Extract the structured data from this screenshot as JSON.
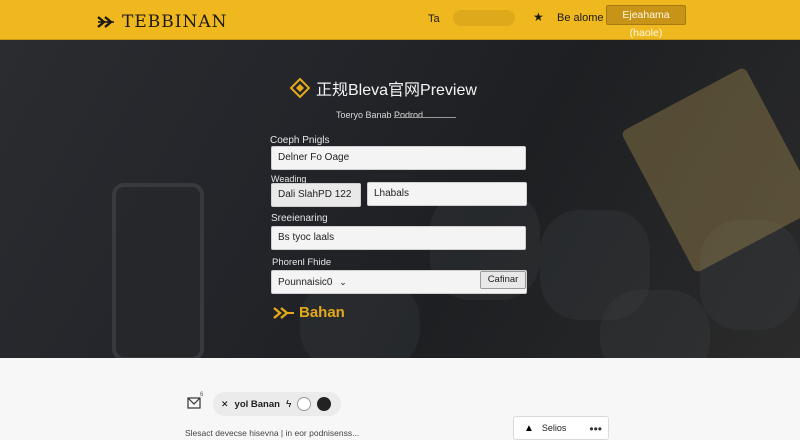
{
  "header": {
    "brand": "TEBBINAN",
    "nav_short": "Ta",
    "nav_link": "Be alome",
    "nav_button": "Ejeahama (haole)",
    "star_icon": "star-icon"
  },
  "hero": {
    "title": "正规Bleva官网Preview",
    "subtitle": "Toeryo Banab Podrod",
    "label_1": "Coeph Pnigls",
    "field_1": "Delner Fo Oage",
    "label_2": "Weading",
    "field_2a": "Dali SlahPD   122",
    "field_2b": "Lhabals",
    "label_3": "Sreeienaring",
    "field_3": "Bs tyoc laals",
    "label_4": "Phorenl Fhide",
    "field_4": "Pounnaisic0",
    "confirm_label": "Cafinar",
    "logo_text": "Bahan",
    "accent": "#f0b81f"
  },
  "lower": {
    "chip_label": "yol Banan",
    "mini_badge": "6",
    "text": "Slesact devecse hisevna | in eor podnisenss...",
    "card_label": "Selios"
  }
}
